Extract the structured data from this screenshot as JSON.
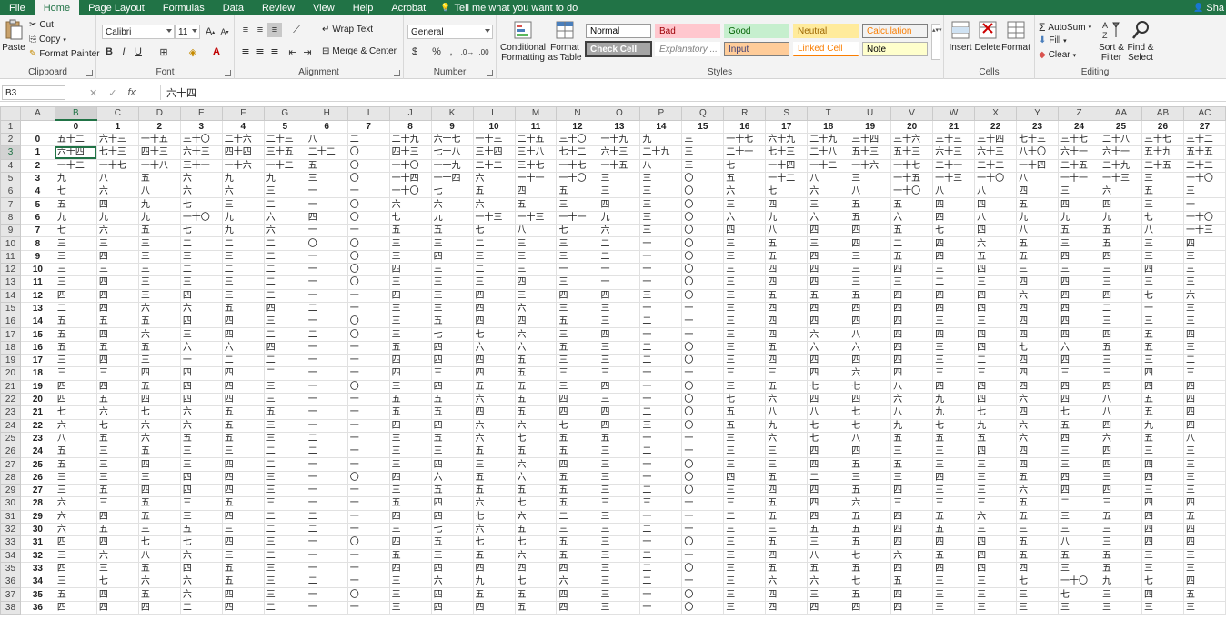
{
  "tabs": [
    "File",
    "Home",
    "Page Layout",
    "Formulas",
    "Data",
    "Review",
    "View",
    "Help",
    "Acrobat"
  ],
  "active_tab": "Home",
  "tell_me": "Tell me what you want to do",
  "user_name": "Sha",
  "clipboard": {
    "paste": "Paste",
    "cut": "Cut",
    "copy": "Copy",
    "format_painter": "Format Painter",
    "label": "Clipboard"
  },
  "font": {
    "name": "Calibri",
    "size": "11",
    "label": "Font",
    "bold": "B",
    "italic": "I",
    "underline": "U"
  },
  "alignment": {
    "wrap_text": "Wrap Text",
    "merge_center": "Merge & Center",
    "label": "Alignment"
  },
  "number": {
    "format": "General",
    "label": "Number"
  },
  "styles": {
    "conditional_formatting": "Conditional Formatting",
    "format_as_table": "Format as Table",
    "cells": [
      {
        "name": "Normal",
        "bg": "#ffffff",
        "color": "#000000",
        "border": "#9a9a9a"
      },
      {
        "name": "Bad",
        "bg": "#ffc7ce",
        "color": "#9c0006",
        "border": "#ffc7ce"
      },
      {
        "name": "Good",
        "bg": "#c6efce",
        "color": "#006100",
        "border": "#c6efce"
      },
      {
        "name": "Neutral",
        "bg": "#ffeb9c",
        "color": "#9c6500",
        "border": "#ffeb9c"
      },
      {
        "name": "Calculation",
        "bg": "#f2f2f2",
        "color": "#fa7d00",
        "border": "#7f7f7f"
      },
      {
        "name": "Check Cell",
        "bg": "#a5a5a5",
        "color": "#ffffff",
        "border": "#3f3f3f"
      },
      {
        "name": "Explanatory ...",
        "bg": "#ffffff",
        "color": "#7f7f7f",
        "border": "#ffffff"
      },
      {
        "name": "Input",
        "bg": "#ffcc99",
        "color": "#3f3f76",
        "border": "#7f7f7f"
      },
      {
        "name": "Linked Cell",
        "bg": "#ffffff",
        "color": "#fa7d00",
        "border": "#ffffff"
      },
      {
        "name": "Note",
        "bg": "#ffffcc",
        "color": "#000000",
        "border": "#b2b2b2"
      }
    ],
    "label": "Styles"
  },
  "cells_group": {
    "insert": "Insert",
    "delete": "Delete",
    "format": "Format",
    "label": "Cells"
  },
  "editing": {
    "autosum": "AutoSum",
    "fill": "Fill",
    "clear": "Clear",
    "sort_filter": "Sort & Filter",
    "find_select": "Find & Select",
    "label": "Editing"
  },
  "name_box": "B3",
  "formula": "六十四",
  "columns": [
    "A",
    "B",
    "C",
    "D",
    "E",
    "F",
    "G",
    "H",
    "I",
    "J",
    "K",
    "L",
    "M",
    "N",
    "O",
    "P",
    "Q",
    "R",
    "S",
    "T",
    "U",
    "V",
    "W",
    "X",
    "Y",
    "Z",
    "AA",
    "AB",
    "AC"
  ],
  "selected_column": "B",
  "selected_row": 3,
  "header_row": [
    "",
    "0",
    "1",
    "2",
    "3",
    "4",
    "5",
    "6",
    "7",
    "8",
    "9",
    "10",
    "11",
    "12",
    "13",
    "14",
    "15",
    "16",
    "17",
    "18",
    "19",
    "20",
    "21",
    "22",
    "23",
    "24",
    "25",
    "26",
    "27"
  ],
  "rows": [
    {
      "n": 2,
      "a": "0",
      "v": [
        "五十二",
        "六十三",
        "一十五",
        "三十〇",
        "二十六",
        "二十三",
        "八",
        "二",
        "二十九",
        "六十七",
        "一十三",
        "二十五",
        "三十〇",
        "一十九",
        "九",
        "三",
        "一十七",
        "六十九",
        "二十九",
        "三十四",
        "三十六",
        "三十三",
        "三十四",
        "七十三",
        "三十七",
        "二十八",
        "三十七",
        "三十二"
      ]
    },
    {
      "n": 3,
      "a": "1",
      "v": [
        "六十四",
        "七十三",
        "四十三",
        "六十三",
        "四十四",
        "三十五",
        "二十二",
        "〇",
        "四十三",
        "七十八",
        "三十四",
        "三十八",
        "七十二",
        "六十三",
        "二十九",
        "三",
        "二十一",
        "七十三",
        "二十八",
        "五十三",
        "五十三",
        "六十三",
        "六十三",
        "八十〇",
        "六十一",
        "六十一",
        "五十九",
        "五十五"
      ]
    },
    {
      "n": 4,
      "a": "2",
      "v": [
        "一十二",
        "一十七",
        "一十八",
        "三十一",
        "一十六",
        "一十二",
        "五",
        "〇",
        "一十〇",
        "一十九",
        "二十二",
        "三十七",
        "一十七",
        "一十五",
        "八",
        "三",
        "七",
        "一十四",
        "一十二",
        "一十六",
        "一十七",
        "二十一",
        "二十二",
        "一十四",
        "二十五",
        "二十九",
        "二十五",
        "二十二"
      ]
    },
    {
      "n": 5,
      "a": "3",
      "v": [
        "九",
        "八",
        "五",
        "六",
        "九",
        "九",
        "三",
        "〇",
        "一十四",
        "一十四",
        "六",
        "一十一",
        "一十〇",
        "三",
        "三",
        "〇",
        "五",
        "一十二",
        "八",
        "三",
        "一十五",
        "一十三",
        "一十〇",
        "八",
        "一十一",
        "一十三",
        "三",
        "一十〇"
      ]
    },
    {
      "n": 6,
      "a": "4",
      "v": [
        "七",
        "六",
        "八",
        "六",
        "六",
        "三",
        "一",
        "一",
        "一十〇",
        "七",
        "五",
        "四",
        "五",
        "三",
        "三",
        "〇",
        "六",
        "七",
        "六",
        "八",
        "一十〇",
        "八",
        "八",
        "四",
        "三",
        "六",
        "五",
        "三"
      ]
    },
    {
      "n": 7,
      "a": "5",
      "v": [
        "五",
        "四",
        "九",
        "七",
        "三",
        "二",
        "一",
        "〇",
        "六",
        "六",
        "六",
        "五",
        "三",
        "四",
        "三",
        "〇",
        "三",
        "四",
        "三",
        "五",
        "五",
        "四",
        "四",
        "五",
        "四",
        "四",
        "三",
        "一"
      ]
    },
    {
      "n": 8,
      "a": "6",
      "v": [
        "九",
        "九",
        "九",
        "一十〇",
        "九",
        "六",
        "四",
        "〇",
        "七",
        "九",
        "一十三",
        "一十三",
        "一十一",
        "九",
        "三",
        "〇",
        "六",
        "九",
        "六",
        "五",
        "六",
        "四",
        "八",
        "九",
        "九",
        "九",
        "七",
        "一十〇"
      ]
    },
    {
      "n": 9,
      "a": "7",
      "v": [
        "七",
        "六",
        "五",
        "七",
        "九",
        "六",
        "一",
        "一",
        "五",
        "五",
        "七",
        "八",
        "七",
        "六",
        "三",
        "〇",
        "四",
        "八",
        "四",
        "四",
        "五",
        "七",
        "四",
        "八",
        "五",
        "五",
        "八",
        "一十三"
      ]
    },
    {
      "n": 10,
      "a": "8",
      "v": [
        "三",
        "三",
        "三",
        "二",
        "二",
        "二",
        "〇",
        "〇",
        "三",
        "三",
        "二",
        "三",
        "三",
        "二",
        "一",
        "〇",
        "三",
        "五",
        "三",
        "四",
        "二",
        "四",
        "六",
        "五",
        "三",
        "五",
        "三",
        "四"
      ]
    },
    {
      "n": 11,
      "a": "9",
      "v": [
        "三",
        "四",
        "三",
        "三",
        "三",
        "二",
        "一",
        "〇",
        "三",
        "四",
        "三",
        "三",
        "三",
        "二",
        "一",
        "〇",
        "三",
        "五",
        "四",
        "三",
        "五",
        "四",
        "五",
        "五",
        "四",
        "四",
        "三",
        "三"
      ]
    },
    {
      "n": 12,
      "a": "10",
      "v": [
        "三",
        "三",
        "三",
        "二",
        "二",
        "二",
        "一",
        "〇",
        "四",
        "三",
        "二",
        "三",
        "一",
        "一",
        "一",
        "〇",
        "三",
        "四",
        "四",
        "三",
        "四",
        "三",
        "四",
        "三",
        "三",
        "三",
        "四",
        "三"
      ]
    },
    {
      "n": 13,
      "a": "11",
      "v": [
        "三",
        "四",
        "三",
        "三",
        "三",
        "二",
        "一",
        "〇",
        "三",
        "三",
        "三",
        "四",
        "三",
        "一",
        "一",
        "〇",
        "三",
        "四",
        "四",
        "三",
        "三",
        "二",
        "三",
        "四",
        "四",
        "三",
        "三",
        "三"
      ]
    },
    {
      "n": 14,
      "a": "12",
      "v": [
        "四",
        "四",
        "三",
        "四",
        "三",
        "二",
        "一",
        "一",
        "四",
        "三",
        "四",
        "三",
        "四",
        "四",
        "三",
        "〇",
        "三",
        "五",
        "五",
        "五",
        "四",
        "四",
        "四",
        "六",
        "四",
        "四",
        "七",
        "六"
      ]
    },
    {
      "n": 15,
      "a": "13",
      "v": [
        "二",
        "四",
        "六",
        "六",
        "五",
        "四",
        "二",
        "一",
        "三",
        "三",
        "四",
        "六",
        "三",
        "三",
        "一",
        "一",
        "三",
        "四",
        "四",
        "四",
        "四",
        "四",
        "四",
        "四",
        "四",
        "二",
        "一",
        "三"
      ]
    },
    {
      "n": 16,
      "a": "14",
      "v": [
        "五",
        "五",
        "五",
        "四",
        "四",
        "三",
        "一",
        "〇",
        "三",
        "五",
        "四",
        "四",
        "五",
        "三",
        "二",
        "一",
        "三",
        "四",
        "四",
        "四",
        "四",
        "三",
        "三",
        "四",
        "四",
        "三",
        "三",
        "三"
      ]
    },
    {
      "n": 17,
      "a": "15",
      "v": [
        "五",
        "四",
        "六",
        "三",
        "四",
        "二",
        "二",
        "〇",
        "三",
        "七",
        "七",
        "六",
        "三",
        "四",
        "一",
        "一",
        "三",
        "四",
        "六",
        "八",
        "四",
        "四",
        "四",
        "四",
        "四",
        "四",
        "五",
        "四"
      ]
    },
    {
      "n": 18,
      "a": "16",
      "v": [
        "五",
        "五",
        "五",
        "六",
        "六",
        "四",
        "一",
        "一",
        "五",
        "四",
        "六",
        "六",
        "五",
        "三",
        "二",
        "〇",
        "三",
        "五",
        "六",
        "六",
        "四",
        "三",
        "四",
        "七",
        "六",
        "五",
        "五",
        "三"
      ]
    },
    {
      "n": 19,
      "a": "17",
      "v": [
        "三",
        "四",
        "三",
        "一",
        "二",
        "二",
        "一",
        "一",
        "四",
        "四",
        "四",
        "五",
        "三",
        "三",
        "二",
        "〇",
        "三",
        "四",
        "四",
        "四",
        "四",
        "三",
        "二",
        "四",
        "四",
        "三",
        "三",
        "二"
      ]
    },
    {
      "n": 20,
      "a": "18",
      "v": [
        "三",
        "三",
        "四",
        "四",
        "四",
        "二",
        "一",
        "一",
        "四",
        "三",
        "四",
        "五",
        "三",
        "三",
        "一",
        "一",
        "三",
        "三",
        "四",
        "六",
        "四",
        "三",
        "三",
        "四",
        "三",
        "三",
        "四",
        "三"
      ]
    },
    {
      "n": 21,
      "a": "19",
      "v": [
        "四",
        "四",
        "五",
        "四",
        "四",
        "三",
        "一",
        "〇",
        "三",
        "四",
        "五",
        "五",
        "三",
        "四",
        "一",
        "〇",
        "三",
        "五",
        "七",
        "七",
        "八",
        "四",
        "四",
        "四",
        "四",
        "四",
        "四",
        "四"
      ]
    },
    {
      "n": 22,
      "a": "20",
      "v": [
        "四",
        "五",
        "四",
        "四",
        "四",
        "三",
        "一",
        "一",
        "五",
        "五",
        "六",
        "五",
        "四",
        "三",
        "一",
        "〇",
        "七",
        "六",
        "四",
        "四",
        "六",
        "九",
        "四",
        "六",
        "四",
        "八",
        "五",
        "四"
      ]
    },
    {
      "n": 23,
      "a": "21",
      "v": [
        "七",
        "六",
        "七",
        "六",
        "五",
        "五",
        "一",
        "一",
        "五",
        "五",
        "四",
        "五",
        "四",
        "四",
        "二",
        "〇",
        "五",
        "八",
        "八",
        "七",
        "八",
        "九",
        "七",
        "四",
        "七",
        "八",
        "五",
        "四"
      ]
    },
    {
      "n": 24,
      "a": "22",
      "v": [
        "六",
        "七",
        "六",
        "六",
        "五",
        "三",
        "一",
        "一",
        "四",
        "四",
        "六",
        "六",
        "七",
        "四",
        "三",
        "〇",
        "五",
        "九",
        "七",
        "七",
        "九",
        "七",
        "九",
        "六",
        "五",
        "四",
        "九",
        "四"
      ]
    },
    {
      "n": 25,
      "a": "23",
      "v": [
        "八",
        "五",
        "六",
        "五",
        "五",
        "三",
        "二",
        "一",
        "三",
        "五",
        "六",
        "七",
        "五",
        "五",
        "一",
        "一",
        "三",
        "六",
        "七",
        "八",
        "五",
        "五",
        "五",
        "六",
        "四",
        "六",
        "五",
        "八"
      ]
    },
    {
      "n": 26,
      "a": "24",
      "v": [
        "五",
        "三",
        "五",
        "三",
        "三",
        "二",
        "二",
        "一",
        "三",
        "三",
        "五",
        "五",
        "五",
        "三",
        "二",
        "一",
        "三",
        "三",
        "四",
        "四",
        "三",
        "三",
        "四",
        "四",
        "三",
        "四",
        "三",
        "三"
      ]
    },
    {
      "n": 27,
      "a": "25",
      "v": [
        "五",
        "三",
        "四",
        "三",
        "四",
        "二",
        "一",
        "一",
        "三",
        "四",
        "三",
        "六",
        "四",
        "三",
        "一",
        "〇",
        "三",
        "三",
        "四",
        "五",
        "五",
        "三",
        "三",
        "四",
        "三",
        "四",
        "四",
        "三"
      ]
    },
    {
      "n": 28,
      "a": "26",
      "v": [
        "三",
        "三",
        "三",
        "四",
        "四",
        "三",
        "一",
        "〇",
        "四",
        "六",
        "五",
        "六",
        "五",
        "三",
        "一",
        "〇",
        "四",
        "五",
        "二",
        "三",
        "三",
        "四",
        "三",
        "五",
        "四",
        "三",
        "四",
        "三"
      ]
    },
    {
      "n": 29,
      "a": "27",
      "v": [
        "三",
        "五",
        "四",
        "四",
        "四",
        "三",
        "一",
        "一",
        "三",
        "五",
        "五",
        "五",
        "五",
        "三",
        "二",
        "〇",
        "三",
        "四",
        "四",
        "五",
        "四",
        "三",
        "三",
        "六",
        "四",
        "四",
        "三",
        "三"
      ]
    },
    {
      "n": 30,
      "a": "28",
      "v": [
        "六",
        "三",
        "五",
        "三",
        "五",
        "三",
        "一",
        "一",
        "五",
        "四",
        "六",
        "七",
        "五",
        "三",
        "三",
        "一",
        "三",
        "五",
        "四",
        "六",
        "三",
        "三",
        "三",
        "五",
        "二",
        "三",
        "四",
        "四"
      ]
    },
    {
      "n": 31,
      "a": "29",
      "v": [
        "六",
        "四",
        "五",
        "三",
        "四",
        "二",
        "二",
        "一",
        "四",
        "四",
        "七",
        "六",
        "二",
        "三",
        "一",
        "一",
        "二",
        "五",
        "四",
        "五",
        "四",
        "五",
        "六",
        "五",
        "三",
        "五",
        "四",
        "五"
      ]
    },
    {
      "n": 32,
      "a": "30",
      "v": [
        "六",
        "五",
        "三",
        "五",
        "三",
        "二",
        "二",
        "一",
        "三",
        "七",
        "六",
        "五",
        "三",
        "三",
        "二",
        "一",
        "三",
        "三",
        "五",
        "五",
        "四",
        "五",
        "三",
        "三",
        "三",
        "三",
        "四",
        "四"
      ]
    },
    {
      "n": 33,
      "a": "31",
      "v": [
        "四",
        "四",
        "七",
        "七",
        "四",
        "三",
        "一",
        "〇",
        "四",
        "五",
        "七",
        "七",
        "五",
        "三",
        "一",
        "〇",
        "三",
        "五",
        "三",
        "五",
        "四",
        "四",
        "四",
        "五",
        "八",
        "三",
        "四",
        "四"
      ]
    },
    {
      "n": 34,
      "a": "32",
      "v": [
        "三",
        "六",
        "八",
        "六",
        "三",
        "二",
        "一",
        "一",
        "五",
        "三",
        "五",
        "六",
        "五",
        "三",
        "二",
        "一",
        "三",
        "四",
        "八",
        "七",
        "六",
        "五",
        "四",
        "五",
        "五",
        "五",
        "三",
        "三"
      ]
    },
    {
      "n": 35,
      "a": "33",
      "v": [
        "四",
        "三",
        "五",
        "四",
        "五",
        "三",
        "一",
        "一",
        "四",
        "四",
        "四",
        "四",
        "四",
        "三",
        "二",
        "〇",
        "三",
        "五",
        "五",
        "五",
        "四",
        "四",
        "四",
        "四",
        "三",
        "五",
        "三",
        "三"
      ]
    },
    {
      "n": 36,
      "a": "34",
      "v": [
        "三",
        "七",
        "六",
        "六",
        "五",
        "三",
        "二",
        "一",
        "三",
        "六",
        "九",
        "七",
        "六",
        "三",
        "二",
        "一",
        "三",
        "六",
        "六",
        "七",
        "五",
        "三",
        "三",
        "七",
        "一十〇",
        "九",
        "七",
        "四"
      ]
    },
    {
      "n": 37,
      "a": "35",
      "v": [
        "五",
        "四",
        "五",
        "六",
        "四",
        "三",
        "一",
        "〇",
        "三",
        "四",
        "五",
        "五",
        "四",
        "三",
        "一",
        "〇",
        "三",
        "四",
        "三",
        "五",
        "四",
        "三",
        "三",
        "三",
        "七",
        "三",
        "四",
        "五"
      ]
    },
    {
      "n": 38,
      "a": "36",
      "v": [
        "四",
        "四",
        "四",
        "二",
        "四",
        "二",
        "一",
        "一",
        "三",
        "四",
        "四",
        "五",
        "四",
        "三",
        "一",
        "〇",
        "三",
        "四",
        "四",
        "四",
        "四",
        "三",
        "三",
        "三",
        "三",
        "三",
        "三",
        "三"
      ]
    }
  ]
}
